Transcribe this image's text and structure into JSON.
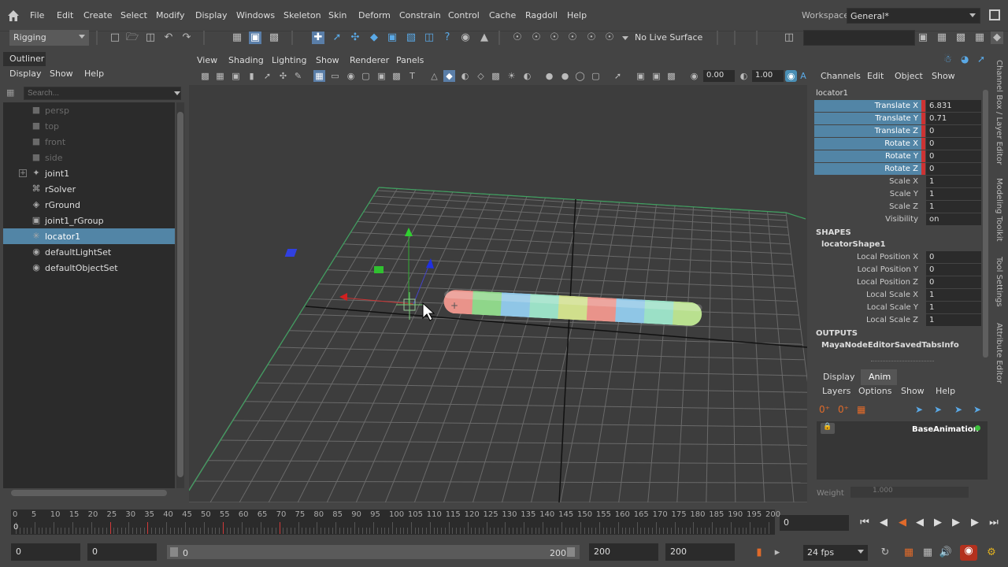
{
  "menubar": {
    "items": [
      "File",
      "Edit",
      "Create",
      "Select",
      "Modify",
      "Display",
      "Windows",
      "Skeleton",
      "Skin",
      "Deform",
      "Constrain",
      "Control",
      "Cache",
      "Ragdoll",
      "Help"
    ],
    "workspace_label": "Workspace:",
    "workspace_value": "General*"
  },
  "toolbar": {
    "mode": "Rigging",
    "live_surface": "No Live Surface"
  },
  "outliner": {
    "tab": "Outliner",
    "menus": [
      "Display",
      "Show",
      "Help"
    ],
    "search_placeholder": "Search...",
    "items": [
      {
        "label": "persp",
        "icon": "camera-icon",
        "dim": true
      },
      {
        "label": "top",
        "icon": "camera-icon",
        "dim": true
      },
      {
        "label": "front",
        "icon": "camera-icon",
        "dim": true
      },
      {
        "label": "side",
        "icon": "camera-icon",
        "dim": true
      },
      {
        "label": "joint1",
        "icon": "joint-icon",
        "dim": false,
        "expand": true
      },
      {
        "label": "rSolver",
        "icon": "solver-icon",
        "dim": false
      },
      {
        "label": "rGround",
        "icon": "ground-icon",
        "dim": false
      },
      {
        "label": "joint1_rGroup",
        "icon": "group-icon",
        "dim": false
      },
      {
        "label": "locator1",
        "icon": "locator-icon",
        "dim": false,
        "selected": true
      },
      {
        "label": "defaultLightSet",
        "icon": "set-icon",
        "dim": false
      },
      {
        "label": "defaultObjectSet",
        "icon": "set-icon",
        "dim": false
      }
    ]
  },
  "viewport": {
    "menus": [
      "View",
      "Shading",
      "Lighting",
      "Show",
      "Renderer",
      "Panels"
    ],
    "exposure": "0.00",
    "gamma": "1.00"
  },
  "channel_box": {
    "menus": [
      "Channels",
      "Edit",
      "Object",
      "Show"
    ],
    "object": "locator1",
    "attributes": [
      {
        "name": "Translate X",
        "value": "6.831",
        "highlight": true
      },
      {
        "name": "Translate Y",
        "value": "0.71",
        "highlight": true
      },
      {
        "name": "Translate Z",
        "value": "0",
        "highlight": true
      },
      {
        "name": "Rotate X",
        "value": "0",
        "highlight": true
      },
      {
        "name": "Rotate Y",
        "value": "0",
        "highlight": true
      },
      {
        "name": "Rotate Z",
        "value": "0",
        "highlight": true
      },
      {
        "name": "Scale X",
        "value": "1",
        "highlight": false
      },
      {
        "name": "Scale Y",
        "value": "1",
        "highlight": false
      },
      {
        "name": "Scale Z",
        "value": "1",
        "highlight": false
      },
      {
        "name": "Visibility",
        "value": "on",
        "highlight": false
      }
    ],
    "shapes_header": "SHAPES",
    "shape_name": "locatorShape1",
    "shape_attributes": [
      {
        "name": "Local Position X",
        "value": "0"
      },
      {
        "name": "Local Position Y",
        "value": "0"
      },
      {
        "name": "Local Position Z",
        "value": "0"
      },
      {
        "name": "Local Scale X",
        "value": "1"
      },
      {
        "name": "Local Scale Y",
        "value": "1"
      },
      {
        "name": "Local Scale Z",
        "value": "1"
      }
    ],
    "outputs_header": "OUTPUTS",
    "output_name": "MayaNodeEditorSavedTabsInfo"
  },
  "side_rail": [
    "Channel Box / Layer Editor",
    "Modeling Toolkit",
    "Tool Settings",
    "Attribute Editor"
  ],
  "layer_editor": {
    "tabs": [
      "Display",
      "Anim"
    ],
    "menus": [
      "Layers",
      "Options",
      "Show",
      "Help"
    ],
    "base_layer": "BaseAnimation",
    "weight_label": "Weight",
    "weight_value": "1.000"
  },
  "timeline": {
    "ticks": [
      "0",
      "5",
      "10",
      "15",
      "20",
      "25",
      "30",
      "35",
      "40",
      "45",
      "50",
      "55",
      "60",
      "65",
      "70",
      "75",
      "80",
      "85",
      "90",
      "95",
      "100",
      "105",
      "110",
      "115",
      "120",
      "125",
      "130",
      "135",
      "140",
      "145",
      "150",
      "155",
      "160",
      "165",
      "170",
      "175",
      "180",
      "185",
      "190",
      "195",
      "200"
    ],
    "current_frame_marker": "0",
    "current_frame": "0"
  },
  "range": {
    "start": "0",
    "anim_start": "0",
    "slider_start": "0",
    "slider_end": "200",
    "anim_end": "200",
    "end": "200",
    "fps": "24 fps"
  }
}
